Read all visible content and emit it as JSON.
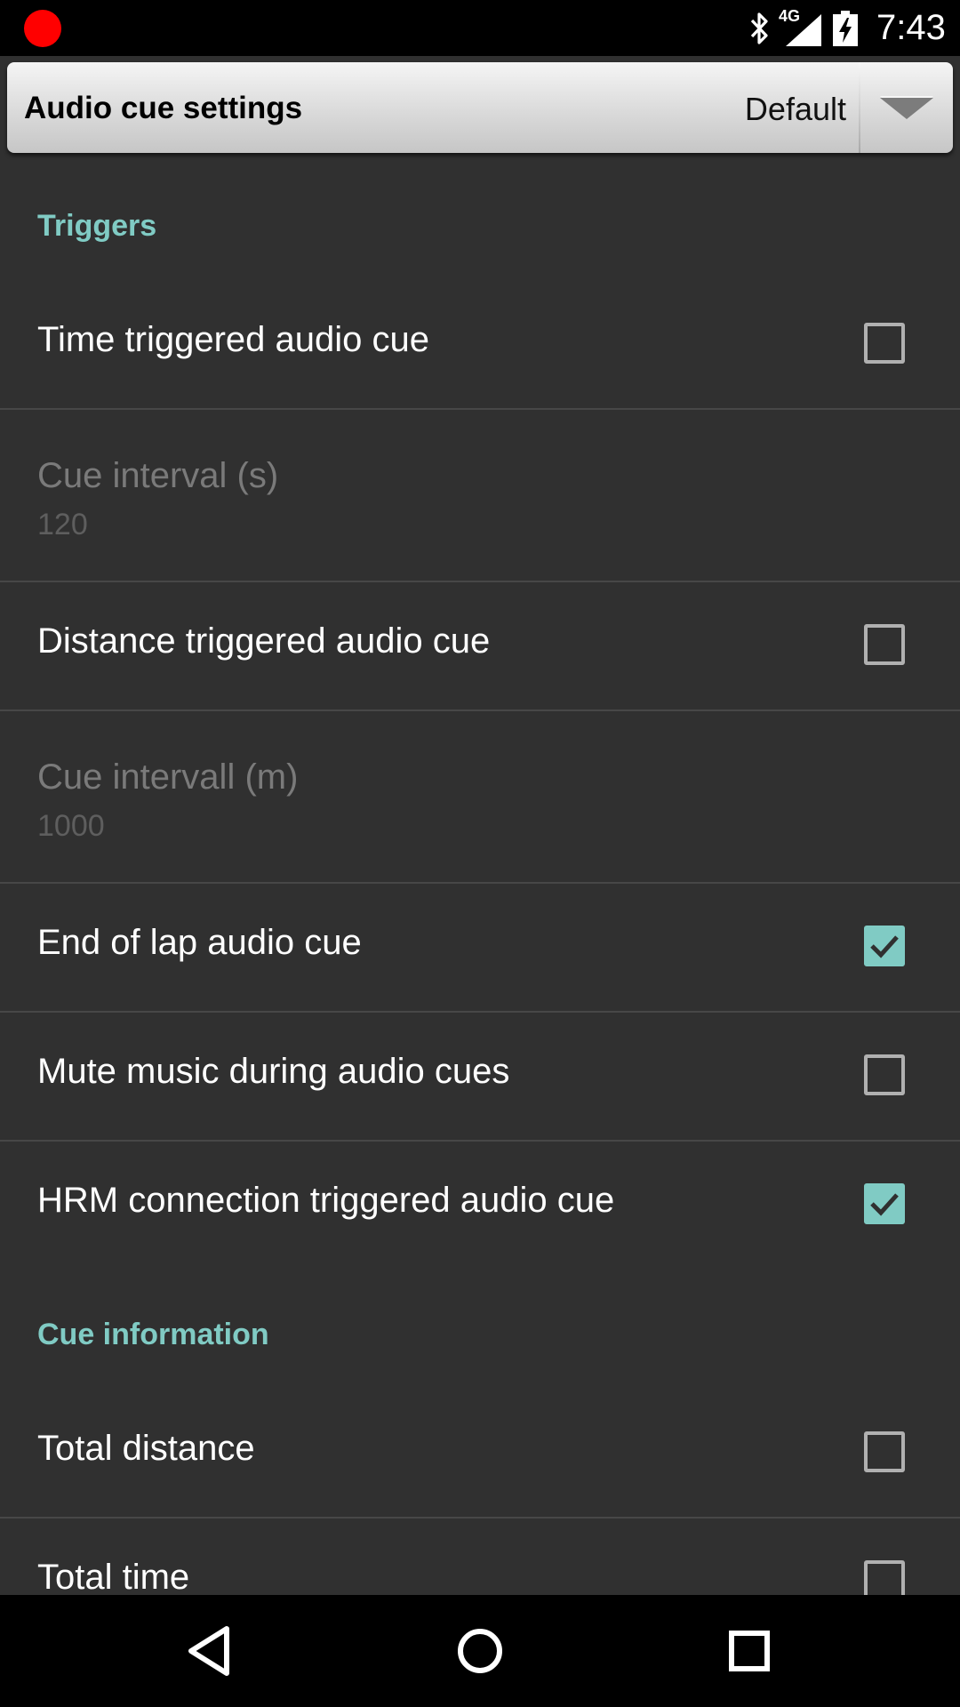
{
  "status_bar": {
    "time": "7:43",
    "network": "4G",
    "icons": [
      "recording-dot-icon",
      "bluetooth-icon",
      "cell-signal-icon",
      "battery-charging-icon"
    ],
    "recording_color": "#ff0000"
  },
  "header": {
    "title": "Audio cue settings",
    "selected_value": "Default",
    "dropdown_icon": "dropdown-arrow-icon"
  },
  "sections": {
    "triggers": {
      "label": "Triggers",
      "time_triggered": {
        "title": "Time triggered audio cue",
        "checked": false
      },
      "cue_interval_s": {
        "title": "Cue interval (s)",
        "summary": "120",
        "enabled": false
      },
      "distance_triggered": {
        "title": "Distance triggered audio cue",
        "checked": false
      },
      "cue_interval_m": {
        "title": "Cue intervall (m)",
        "summary": "1000",
        "enabled": false
      },
      "end_of_lap": {
        "title": "End of lap audio cue",
        "checked": true
      },
      "mute_music": {
        "title": "Mute music during audio cues",
        "checked": false
      },
      "hrm_connection": {
        "title": "HRM connection triggered audio cue",
        "checked": true
      }
    },
    "cue_information": {
      "label": "Cue information",
      "total_distance": {
        "title": "Total distance",
        "checked": false
      },
      "total_time": {
        "title": "Total time",
        "checked": false
      }
    }
  },
  "nav_bar": {
    "icons": [
      "back-icon",
      "home-icon",
      "recents-icon"
    ]
  },
  "colors": {
    "accent": "#80cbc4",
    "background": "#303030",
    "divider": "#474747",
    "disabled_text": "#7a7a7a"
  }
}
